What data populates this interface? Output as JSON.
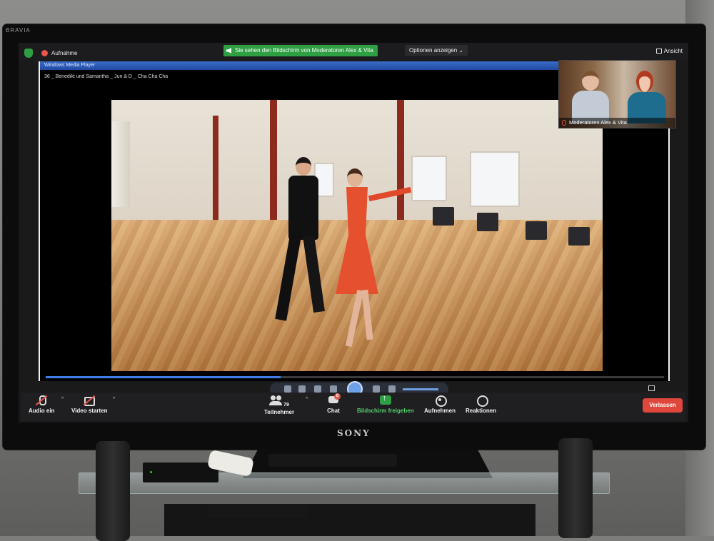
{
  "tv": {
    "brand_corner": "BRAVIA",
    "brand_center": "SONY"
  },
  "zoom_top": {
    "recording_label": "Aufnahme",
    "share_banner": "Sie sehen den Bildschirm von Moderatoren Alex & Vita",
    "options_label": "Optionen anzeigen",
    "view_label": "Ansicht"
  },
  "media_player": {
    "window_title": "Windows Media Player",
    "file_name": "36 _ Benedikt und Samantha _ Jun & D _ Cha Cha Cha",
    "progress": 0.38
  },
  "participant_thumbnail": {
    "name": "Moderatoren Alex & Vita"
  },
  "toolbar": {
    "audio_label": "Audio ein",
    "video_label": "Video starten",
    "participants_label": "Teilnehmer",
    "participants_count": "79",
    "chat_label": "Chat",
    "chat_badge": "8",
    "share_label": "Bildschirm freigeben",
    "record_label": "Aufnehmen",
    "reactions_label": "Reaktionen",
    "leave_label": "Verlassen"
  },
  "colors": {
    "zoom_green": "#2ea043",
    "leave_red": "#e0473c",
    "player_accent": "#3f7ee8"
  },
  "icons": [
    "shield-icon",
    "record-icon",
    "speaker-icon",
    "chevron-down-icon",
    "grid-icon",
    "mic-muted-icon",
    "camera-off-icon",
    "participants-icon",
    "chat-icon",
    "share-screen-icon",
    "record-button-icon",
    "reactions-icon",
    "play-pause-icon",
    "fullscreen-icon"
  ]
}
